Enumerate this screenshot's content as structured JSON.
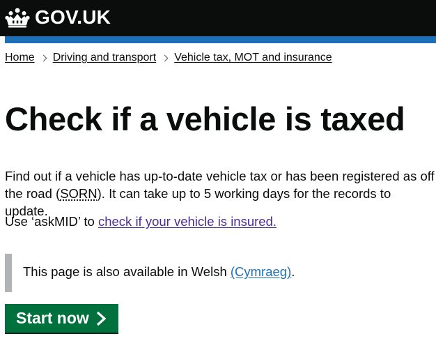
{
  "header": {
    "logo_text": "GOV.UK",
    "background": "#0b0c0c",
    "accent_bar": "#1d70b8",
    "crown_icon": "crown-icon"
  },
  "breadcrumb": {
    "items": [
      "Home",
      "Driving and transport",
      "Vehicle tax, MOT and insurance"
    ],
    "separator_icon": "chevron-right-icon"
  },
  "page": {
    "title": "Check if a vehicle is taxed",
    "lede_before": "Find out if a vehicle has up-to-date vehicle tax or has been registered as off the road (",
    "lede_abbr": "SORN",
    "lede_after": "). It can take up to 5 working days for the records to update.",
    "insurance_before": "Use ‘askMID’ to ",
    "insurance_link": "check if your vehicle is insured.",
    "link_visited_color": "#4c2c92",
    "link_color": "#1d70b8"
  },
  "welsh_notice": {
    "before": "This page is also available in Welsh ",
    "link": "(Cymraeg)",
    "after": ".",
    "border_color": "#b1b4b6"
  },
  "start_button": {
    "label": "Start now",
    "background": "#00703c",
    "arrow_icon": "arrow-right-icon"
  }
}
